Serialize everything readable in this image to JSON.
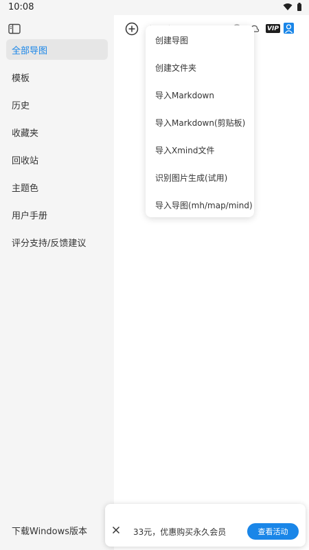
{
  "status_bar": {
    "time": "10:08"
  },
  "sidebar": {
    "items": [
      {
        "label": "全部导图",
        "active": true
      },
      {
        "label": "模板"
      },
      {
        "label": "历史"
      },
      {
        "label": "收藏夹"
      },
      {
        "label": "回收站"
      },
      {
        "label": "主题色"
      },
      {
        "label": "用户手册"
      },
      {
        "label": "评分支持/反馈建议"
      }
    ],
    "download_label": "下载Windows版本"
  },
  "toolbar": {
    "vip_label": "VIP"
  },
  "dropdown": {
    "items": [
      {
        "label": "创建导图"
      },
      {
        "label": "创建文件夹"
      },
      {
        "label": "导入Markdown"
      },
      {
        "label": "导入Markdown(剪贴板)"
      },
      {
        "label": "导入Xmind文件"
      },
      {
        "label": "识别图片生成(试用)"
      },
      {
        "label": "导入导图(mh/map/mind)"
      }
    ]
  },
  "promo": {
    "text": "33元，优惠购买永久会员",
    "button_label": "查看活动"
  },
  "colors": {
    "accent": "#1a86e8",
    "sidebar_bg": "#f5f5f5",
    "active_bg": "#e6e6e6"
  }
}
